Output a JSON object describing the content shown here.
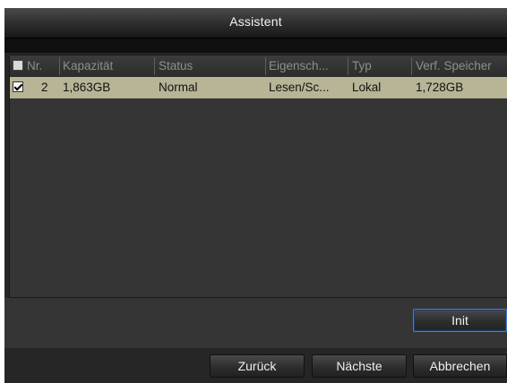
{
  "window": {
    "title": "Assistent"
  },
  "table": {
    "headers": {
      "nr": "Nr.",
      "capacity": "Kapazität",
      "status": "Status",
      "properties": "Eigensch...",
      "type": "Typ",
      "free_space": "Verf. Speicher"
    },
    "rows": [
      {
        "checked": true,
        "nr": "2",
        "capacity": "1,863GB",
        "status": "Normal",
        "properties": "Lesen/Sc...",
        "type": "Lokal",
        "free_space": "1,728GB"
      }
    ]
  },
  "buttons": {
    "init": "Init",
    "back": "Zurück",
    "next": "Nächste",
    "cancel": "Abbrechen"
  },
  "colors": {
    "selected_row": "#b7b596",
    "focus_border": "#3f7fd8"
  }
}
